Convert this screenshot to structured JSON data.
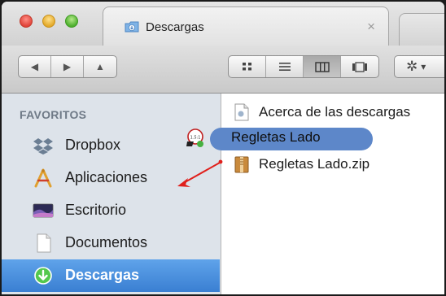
{
  "tab": {
    "title": "Descargas",
    "close_glyph": "×"
  },
  "toolbar": {
    "back_glyph": "◀",
    "forward_glyph": "▶",
    "eject_glyph": "▲",
    "action_glyph": "✲",
    "action_menu_glyph": "▾"
  },
  "sidebar": {
    "header": "FAVORITOS",
    "items": [
      {
        "label": "Dropbox",
        "icon": "dropbox-icon"
      },
      {
        "label": "Aplicaciones",
        "icon": "applications-icon"
      },
      {
        "label": "Escritorio",
        "icon": "desktop-icon"
      },
      {
        "label": "Documentos",
        "icon": "documents-icon"
      },
      {
        "label": "Descargas",
        "icon": "downloads-icon",
        "selected": true
      }
    ]
  },
  "files": [
    {
      "name": "Acerca de las descargas",
      "icon": "document-icon"
    },
    {
      "name": "Regletas Lado",
      "icon": "folder-icon",
      "state": "renaming"
    },
    {
      "name": "Regletas Lado.zip",
      "icon": "zip-archive-icon"
    }
  ],
  "colors": {
    "selection": "#3a7fd2",
    "rename_highlight": "#5d87c9",
    "annotation_arrow": "#e0201c"
  }
}
